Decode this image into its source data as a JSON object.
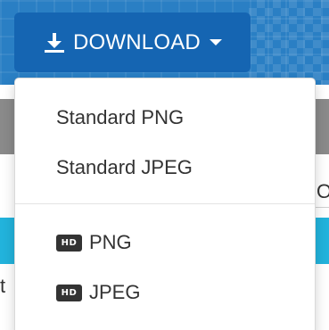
{
  "download_button": {
    "icon": "download-icon",
    "label": "DOWNLOAD",
    "caret_icon": "caret-down-icon"
  },
  "dropdown": {
    "standard_items": [
      {
        "label": "Standard PNG"
      },
      {
        "label": "Standard JPEG"
      }
    ],
    "hd_items": [
      {
        "badge": "HD",
        "label": "PNG"
      },
      {
        "badge": "HD",
        "label": "JPEG"
      }
    ]
  },
  "background": {
    "partial_text_right": "Or",
    "partial_text_left": "t"
  },
  "colors": {
    "button_bg": "#1565b2",
    "header_bg": "#2a7fc4",
    "gray_band": "#8a8a8a",
    "cyan_band": "#22b3dc",
    "menu_text": "#333333",
    "hd_badge_bg": "#333333"
  }
}
